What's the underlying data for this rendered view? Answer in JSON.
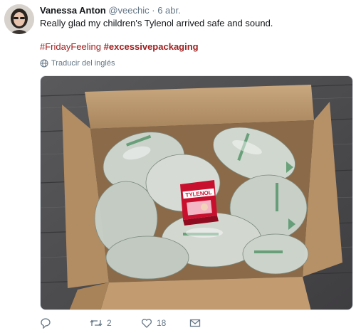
{
  "tweet": {
    "author_name": "Vanessa Anton",
    "handle": "@veechic",
    "separator": "·",
    "time": "6 abr.",
    "text": "Really glad my children's Tylenol arrived safe and sound.",
    "hashtag_1": "#FridayFeeling",
    "hashtag_2": "#excessivepackaging",
    "translate_label": "Traducir del inglés",
    "media_label": "TYLENOL"
  },
  "actions": {
    "reply_icon": "reply-icon",
    "retweet_icon": "retweet-icon",
    "retweet_count": "2",
    "like_icon": "heart-icon",
    "like_count": "18",
    "dm_icon": "envelope-icon"
  },
  "colors": {
    "hashtag": "#a02020",
    "muted": "#657786",
    "text": "#14171a"
  }
}
